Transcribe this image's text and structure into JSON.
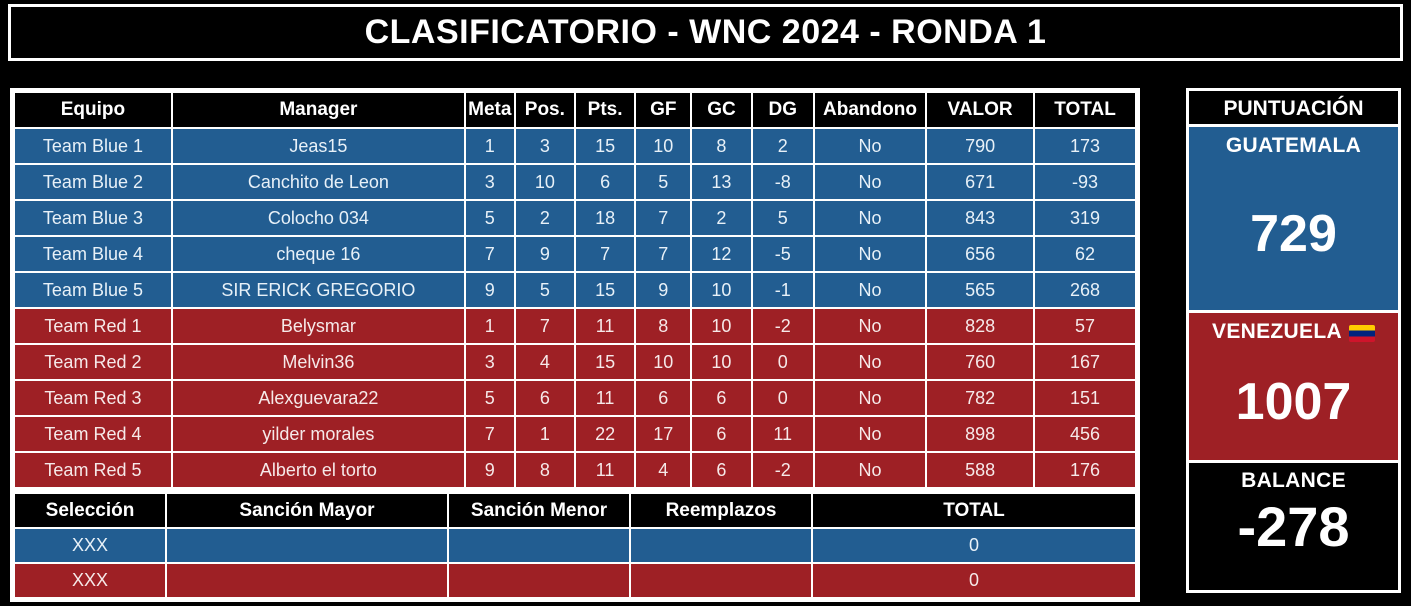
{
  "title": "CLASIFICATORIO - WNC 2024 - RONDA 1",
  "colors": {
    "blue": "#225d91",
    "red": "#9e2025",
    "black": "#000000",
    "white": "#ffffff"
  },
  "main_table": {
    "headers": [
      "Equipo",
      "Manager",
      "Meta",
      "Pos.",
      "Pts.",
      "GF",
      "GC",
      "DG",
      "Abandono",
      "VALOR",
      "TOTAL"
    ],
    "rows": [
      {
        "side": "blue",
        "equipo": "Team Blue 1",
        "manager": "Jeas15",
        "meta": "1",
        "pos": "3",
        "pts": "15",
        "gf": "10",
        "gc": "8",
        "dg": "2",
        "abandono": "No",
        "valor": "790",
        "total": "173"
      },
      {
        "side": "blue",
        "equipo": "Team Blue 2",
        "manager": "Canchito de Leon",
        "meta": "3",
        "pos": "10",
        "pts": "6",
        "gf": "5",
        "gc": "13",
        "dg": "-8",
        "abandono": "No",
        "valor": "671",
        "total": "-93"
      },
      {
        "side": "blue",
        "equipo": "Team Blue 3",
        "manager": "Colocho 034",
        "meta": "5",
        "pos": "2",
        "pts": "18",
        "gf": "7",
        "gc": "2",
        "dg": "5",
        "abandono": "No",
        "valor": "843",
        "total": "319"
      },
      {
        "side": "blue",
        "equipo": "Team Blue 4",
        "manager": "cheque 16",
        "meta": "7",
        "pos": "9",
        "pts": "7",
        "gf": "7",
        "gc": "12",
        "dg": "-5",
        "abandono": "No",
        "valor": "656",
        "total": "62"
      },
      {
        "side": "blue",
        "equipo": "Team Blue 5",
        "manager": "SIR ERICK GREGORIO",
        "meta": "9",
        "pos": "5",
        "pts": "15",
        "gf": "9",
        "gc": "10",
        "dg": "-1",
        "abandono": "No",
        "valor": "565",
        "total": "268"
      },
      {
        "side": "red",
        "equipo": "Team Red 1",
        "manager": "Belysmar",
        "meta": "1",
        "pos": "7",
        "pts": "11",
        "gf": "8",
        "gc": "10",
        "dg": "-2",
        "abandono": "No",
        "valor": "828",
        "total": "57"
      },
      {
        "side": "red",
        "equipo": "Team Red 2",
        "manager": "Melvin36",
        "meta": "3",
        "pos": "4",
        "pts": "15",
        "gf": "10",
        "gc": "10",
        "dg": "0",
        "abandono": "No",
        "valor": "760",
        "total": "167"
      },
      {
        "side": "red",
        "equipo": "Team Red 3",
        "manager": "Alexguevara22",
        "meta": "5",
        "pos": "6",
        "pts": "11",
        "gf": "6",
        "gc": "6",
        "dg": "0",
        "abandono": "No",
        "valor": "782",
        "total": "151"
      },
      {
        "side": "red",
        "equipo": "Team Red 4",
        "manager": "yilder morales",
        "meta": "7",
        "pos": "1",
        "pts": "22",
        "gf": "17",
        "gc": "6",
        "dg": "11",
        "abandono": "No",
        "valor": "898",
        "total": "456"
      },
      {
        "side": "red",
        "equipo": "Team Red 5",
        "manager": "Alberto el torto",
        "meta": "9",
        "pos": "8",
        "pts": "11",
        "gf": "4",
        "gc": "6",
        "dg": "-2",
        "abandono": "No",
        "valor": "588",
        "total": "176"
      }
    ]
  },
  "bottom_table": {
    "headers": [
      "Selección",
      "Sanción Mayor",
      "Sanción Menor",
      "Reemplazos",
      "TOTAL"
    ],
    "rows": [
      {
        "side": "blue",
        "seleccion": "XXX",
        "sancion_mayor": "",
        "sancion_menor": "",
        "reemplazos": "",
        "total": "0"
      },
      {
        "side": "red",
        "seleccion": "XXX",
        "sancion_mayor": "",
        "sancion_menor": "",
        "reemplazos": "",
        "total": "0"
      }
    ]
  },
  "score_panel": {
    "header": "PUNTUACIÓN",
    "blocks": [
      {
        "side": "blue",
        "country": "GUATEMALA",
        "flag": "",
        "value": "729"
      },
      {
        "side": "red",
        "country": "VENEZUELA",
        "flag": "venezuela-flag-icon",
        "value": "1007"
      },
      {
        "side": "balance",
        "country": "BALANCE",
        "flag": "",
        "value": "-278"
      }
    ]
  }
}
